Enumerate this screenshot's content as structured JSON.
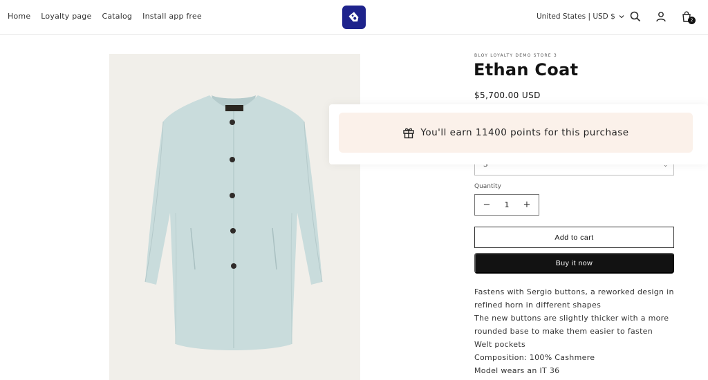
{
  "header": {
    "nav": [
      "Home",
      "Loyalty page",
      "Catalog",
      "Install app free"
    ],
    "locale": "United States | USD $",
    "cart_count": "2"
  },
  "product": {
    "vendor": "BLOY LOYALTY DEMO STORE 3",
    "title": "Ethan Coat",
    "price": "$5,700.00 USD",
    "points_message": "You'll earn 11400 points for this purchase",
    "variant_value": "S",
    "quantity_label": "Quantity",
    "quantity_value": "1",
    "add_to_cart": "Add to cart",
    "buy_now": "Buy it now",
    "description": [
      "Fastens with Sergio buttons, a reworked design in refined horn in different shapes",
      "The new buttons are slightly thicker with a more rounded base to make them easier to fasten",
      "Welt pockets",
      "Composition: 100% Cashmere",
      "Model wears an IT 36"
    ]
  },
  "colors": {
    "logo_bg": "#1e238c",
    "points_banner_bg": "#fbf1ea",
    "coat": "#c9dcdc",
    "primary_button": "#121212"
  },
  "icons": [
    "tag-icon",
    "search-icon",
    "account-icon",
    "cart-icon",
    "gift-icon",
    "chevron-down-icon",
    "minus-icon",
    "plus-icon"
  ]
}
